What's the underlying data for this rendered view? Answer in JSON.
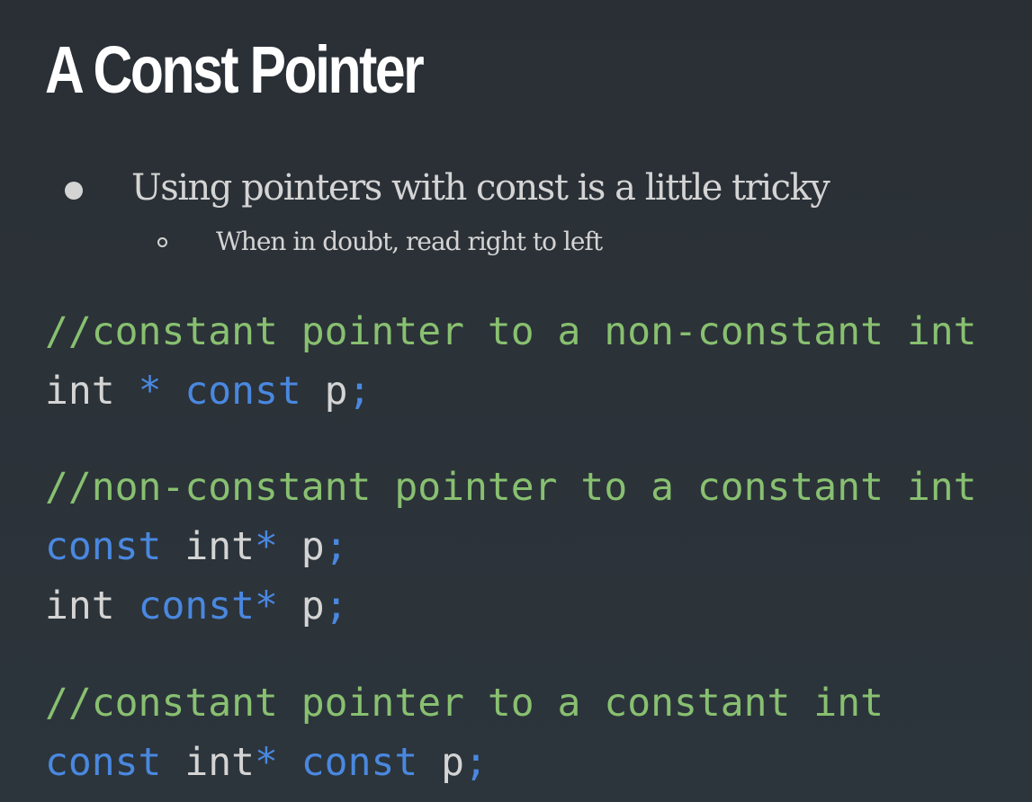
{
  "slide": {
    "title": "A Const Pointer",
    "bullets": {
      "main": "Using pointers with const is a little tricky",
      "sub": "When in doubt, read right to left"
    },
    "code": {
      "line1": {
        "comment": "//constant pointer to a non-constant int"
      },
      "line2": {
        "t1": "int ",
        "t2": "* ",
        "t3": "const",
        "t4": " p",
        "t5": ";"
      },
      "line3": {
        "comment": "//non-constant pointer to a constant int"
      },
      "line4": {
        "t1": "const",
        "t2": " int",
        "t3": "*",
        "t4": " p",
        "t5": ";"
      },
      "line5": {
        "t1": "int ",
        "t2": "const",
        "t3": "*",
        "t4": " p",
        "t5": ";"
      },
      "line6": {
        "comment": "//constant pointer to a constant int"
      },
      "line7": {
        "t1": "const",
        "t2": " int",
        "t3": "*",
        "t4": " ",
        "t5": "const",
        "t6": " p",
        "t7": ";"
      }
    }
  },
  "colors": {
    "background": "#2b3238",
    "title": "#ffffff",
    "text": "#d4d4d4",
    "comment": "#88c070",
    "keyword": "#4a88e0"
  },
  "icons": {
    "bullet_main": "filled-circle-bullet",
    "bullet_sub": "hollow-circle-bullet"
  }
}
